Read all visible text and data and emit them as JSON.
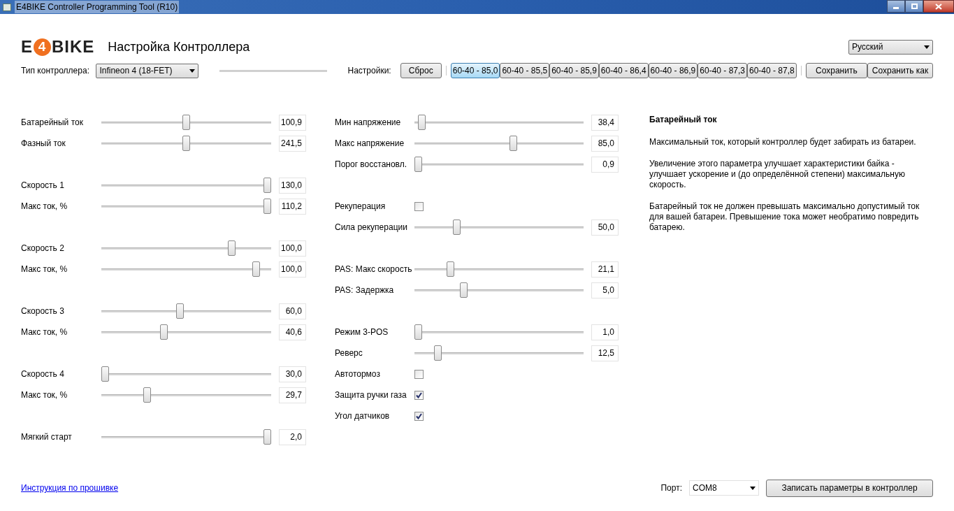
{
  "window": {
    "title": "E4BIKE Controller Programming Tool (R10)"
  },
  "header": {
    "logo_left": "E",
    "logo_digit": "4",
    "logo_right": "BIKE",
    "title": "Настройка Контроллера",
    "language": "Русский"
  },
  "toolbar": {
    "controller_label": "Тип контроллера:",
    "controller_value": "Infineon 4 (18-FET)",
    "settings_label": "Настройки:",
    "reset": "Сброс",
    "presets": [
      {
        "label": "60-40 - 85,0",
        "selected": true
      },
      {
        "label": "60-40 - 85,5",
        "selected": false
      },
      {
        "label": "60-40 - 85,9",
        "selected": false
      },
      {
        "label": "60-40 - 86,4",
        "selected": false
      },
      {
        "label": "60-40 - 86,9",
        "selected": false
      },
      {
        "label": "60-40 - 87,3",
        "selected": false
      },
      {
        "label": "60-40 - 87,8",
        "selected": false
      }
    ],
    "save": "Сохранить",
    "save_as": "Сохранить как"
  },
  "left_groups": [
    [
      {
        "kind": "slider",
        "label": "Батарейный ток",
        "level": 0.5,
        "value": "100,9"
      },
      {
        "kind": "slider",
        "label": "Фазный ток",
        "level": 0.5,
        "value": "241,5"
      }
    ],
    [
      {
        "kind": "slider",
        "label": "Скорость 1",
        "level": 1,
        "value": "130,0"
      },
      {
        "kind": "slider",
        "label": "Макс ток, %",
        "level": 1,
        "value": "110,2"
      }
    ],
    [
      {
        "kind": "slider",
        "label": "Скорость 2",
        "level": 0.78,
        "value": "100,0"
      },
      {
        "kind": "slider",
        "label": "Макс ток, %",
        "level": 0.93,
        "value": "100,0"
      }
    ],
    [
      {
        "kind": "slider",
        "label": "Скорость 3",
        "level": 0.46,
        "value": "60,0"
      },
      {
        "kind": "slider",
        "label": "Макс ток, %",
        "level": 0.36,
        "value": "40,6"
      }
    ],
    [
      {
        "kind": "slider",
        "label": "Скорость 4",
        "level": 0,
        "value": "30,0"
      },
      {
        "kind": "slider",
        "label": "Макс ток, %",
        "level": 0.26,
        "value": "29,7"
      }
    ],
    [
      {
        "kind": "slider",
        "label": "Мягкий старт",
        "level": 1,
        "value": "2,0"
      }
    ]
  ],
  "middle_groups": [
    [
      {
        "kind": "slider",
        "label": "Мин напряжение",
        "level": 0.02,
        "value": "38,4"
      },
      {
        "kind": "slider",
        "label": "Макс напряжение",
        "level": 0.59,
        "value": "85,0"
      },
      {
        "kind": "slider",
        "label": "Порог восстановл.",
        "level": 0,
        "value": "0,9"
      }
    ],
    [
      {
        "kind": "checkbox",
        "label": "Рекуперация",
        "checked": false
      },
      {
        "kind": "slider",
        "label": "Сила рекуперации",
        "level": 0.24,
        "value": "50,0"
      }
    ],
    [
      {
        "kind": "slider",
        "label": "PAS: Макс скорость",
        "level": 0.2,
        "value": "21,1"
      },
      {
        "kind": "slider",
        "label": "PAS: Задержка",
        "level": 0.28,
        "value": "5,0"
      }
    ],
    [
      {
        "kind": "slider",
        "label": "Режим 3-POS",
        "level": 0,
        "value": "1,0"
      },
      {
        "kind": "slider",
        "label": "Реверс",
        "level": 0.12,
        "value": "12,5"
      },
      {
        "kind": "checkbox",
        "label": "Автотормоз",
        "checked": false
      },
      {
        "kind": "checkbox",
        "label": "Защита ручки газа",
        "checked": true
      },
      {
        "kind": "checkbox",
        "label": "Угол датчиков",
        "checked": true
      }
    ]
  ],
  "help": {
    "title": "Батарейный ток",
    "paragraphs": [
      "Максимальный ток, который контроллер будет забирать из батареи.",
      "Увеличение этого параметра улучшает характеристики байка - улучшает ускорение и (до определённой степени) максимальную скорость.",
      "Батарейный ток не должен превышать максимально допустимый ток для вашей батареи. Превышение тока может необратимо повредить батарею."
    ]
  },
  "footer": {
    "link": "Инструкция по прошивке",
    "port_label": "Порт:",
    "port": "COM8",
    "write": "Записать параметры в контроллер"
  }
}
